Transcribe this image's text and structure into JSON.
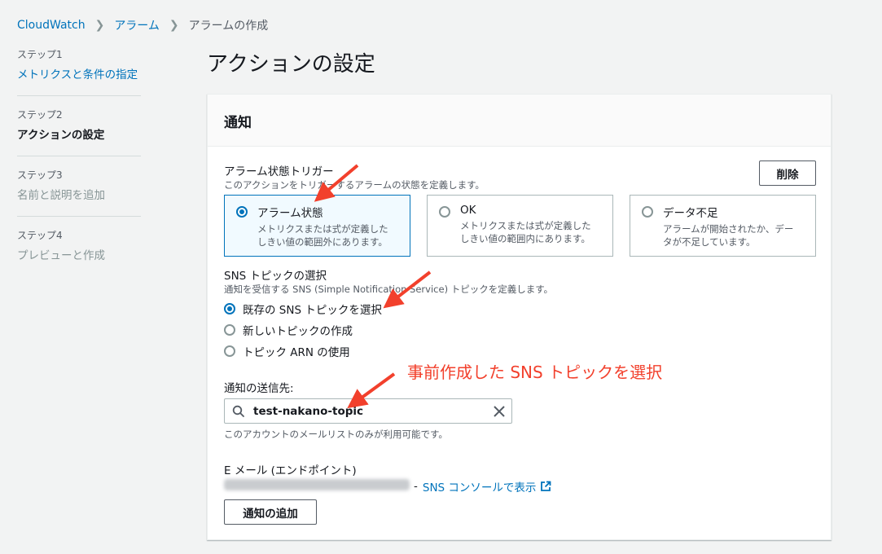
{
  "breadcrumb": {
    "root": "CloudWatch",
    "alarms": "アラーム",
    "current": "アラームの作成"
  },
  "steps": [
    {
      "num": "ステップ1",
      "label": "メトリクスと条件の指定"
    },
    {
      "num": "ステップ2",
      "label": "アクションの設定"
    },
    {
      "num": "ステップ3",
      "label": "名前と説明を追加"
    },
    {
      "num": "ステップ4",
      "label": "プレビューと作成"
    }
  ],
  "page_title": "アクションの設定",
  "panel": {
    "title": "通知",
    "trigger": {
      "label": "アラーム状態トリガー",
      "desc": "このアクションをトリガーするアラームの状態を定義します。",
      "remove_label": "削除",
      "options": [
        {
          "title": "アラーム状態",
          "desc1": "メトリクスまたは式が定義した",
          "desc2": "しきい値の範囲外にあります。"
        },
        {
          "title": "OK",
          "desc1": "メトリクスまたは式が定義した",
          "desc2": "しきい値の範囲内にあります。"
        },
        {
          "title": "データ不足",
          "desc1": "アラームが開始されたか、デー",
          "desc2": "タが不足しています。"
        }
      ],
      "selected": "アラーム状態"
    },
    "sns": {
      "label": "SNS トピックの選択",
      "desc": "通知を受信する SNS (Simple Notification Service) トピックを定義します。",
      "options": [
        "既存の SNS トピックを選択",
        "新しいトピックの作成",
        "トピック ARN の使用"
      ],
      "selected": "既存の SNS トピックを選択"
    },
    "send_to": {
      "label": "通知の送信先:",
      "value": "test-nakano-topic",
      "hint": "このアカウントのメールリストのみが利用可能です。"
    },
    "email": {
      "label": "E メール (エンドポイント)",
      "separator": "-",
      "console_link": "SNS コンソールで表示"
    },
    "add_notification": "通知の追加"
  },
  "annotation": "事前作成した SNS トピックを選択",
  "colors": {
    "link": "#0073bb",
    "annotation": "#f2402c",
    "background": "#f2f3f3"
  }
}
